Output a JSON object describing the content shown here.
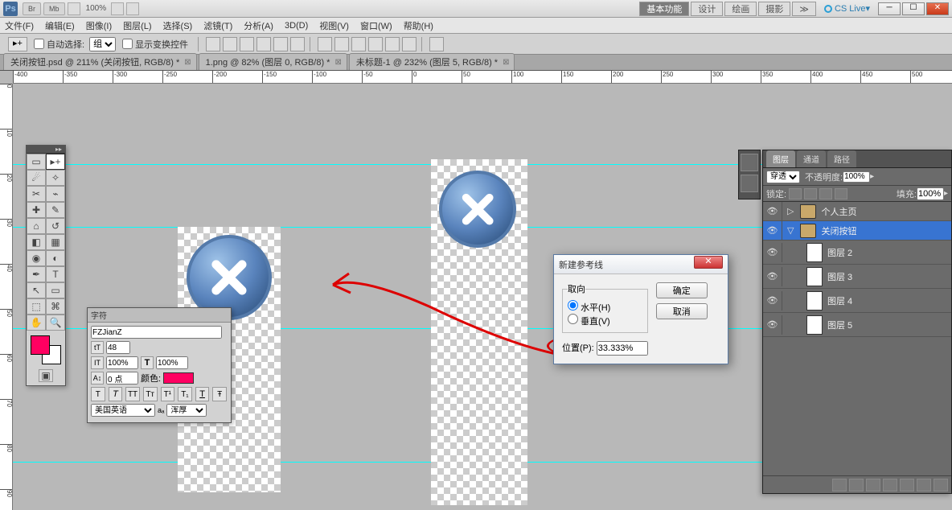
{
  "titlebar": {
    "ps": "Ps",
    "br": "Br",
    "mb": "Mb",
    "zoom": "100%",
    "workspaces": {
      "basic": "基本功能",
      "design": "设计",
      "paint": "绘画",
      "photo": "摄影",
      "more": "≫"
    },
    "cslive": "CS Live"
  },
  "menubar": [
    "文件(F)",
    "编辑(E)",
    "图像(I)",
    "图层(L)",
    "选择(S)",
    "滤镜(T)",
    "分析(A)",
    "3D(D)",
    "视图(V)",
    "窗口(W)",
    "帮助(H)"
  ],
  "optbar": {
    "autosel": "自动选择:",
    "group": "组",
    "showtransform": "显示变换控件"
  },
  "tabs": [
    "关闭按钮.psd @ 211% (关闭按钮, RGB/8) *",
    "1.png @ 82% (图层 0, RGB/8) *",
    "未标题-1 @ 232% (图层 5, RGB/8) *"
  ],
  "char": {
    "tab": "字符",
    "font": "FZJianZ",
    "size": "48",
    "horiz": "100%",
    "vert": "100%",
    "baseline": "0 点",
    "color_label": "颜色:",
    "lang": "美国英语",
    "aa": "浑厚"
  },
  "dialog": {
    "title": "新建参考线",
    "orient": "取向",
    "horizontal": "水平(H)",
    "vertical": "垂直(V)",
    "pos_label": "位置(P):",
    "pos_value": "33.333%",
    "ok": "确定",
    "cancel": "取消"
  },
  "layers": {
    "tabs": {
      "layers": "图层",
      "channels": "通道",
      "paths": "路径"
    },
    "blend": "穿透",
    "opacity_label": "不透明度:",
    "opacity": "100%",
    "lock_label": "锁定:",
    "fill_label": "填充:",
    "fill": "100%",
    "items": [
      {
        "name": "个人主页",
        "type": "folder",
        "open": false
      },
      {
        "name": "关闭按钮",
        "type": "folder",
        "open": true,
        "sel": true
      },
      {
        "name": "图层 2",
        "type": "layer"
      },
      {
        "name": "图层 3",
        "type": "layer"
      },
      {
        "name": "图层 4",
        "type": "layer"
      },
      {
        "name": "图层 5",
        "type": "layer"
      }
    ]
  },
  "ruler_h": [
    -400,
    -350,
    -300,
    -250,
    -200,
    -150,
    -100,
    -50,
    0,
    50,
    100,
    150,
    200,
    250,
    300,
    350,
    400,
    450,
    500
  ],
  "ruler_v": [
    0,
    10,
    20,
    30,
    40,
    50,
    60,
    70,
    80,
    90
  ]
}
